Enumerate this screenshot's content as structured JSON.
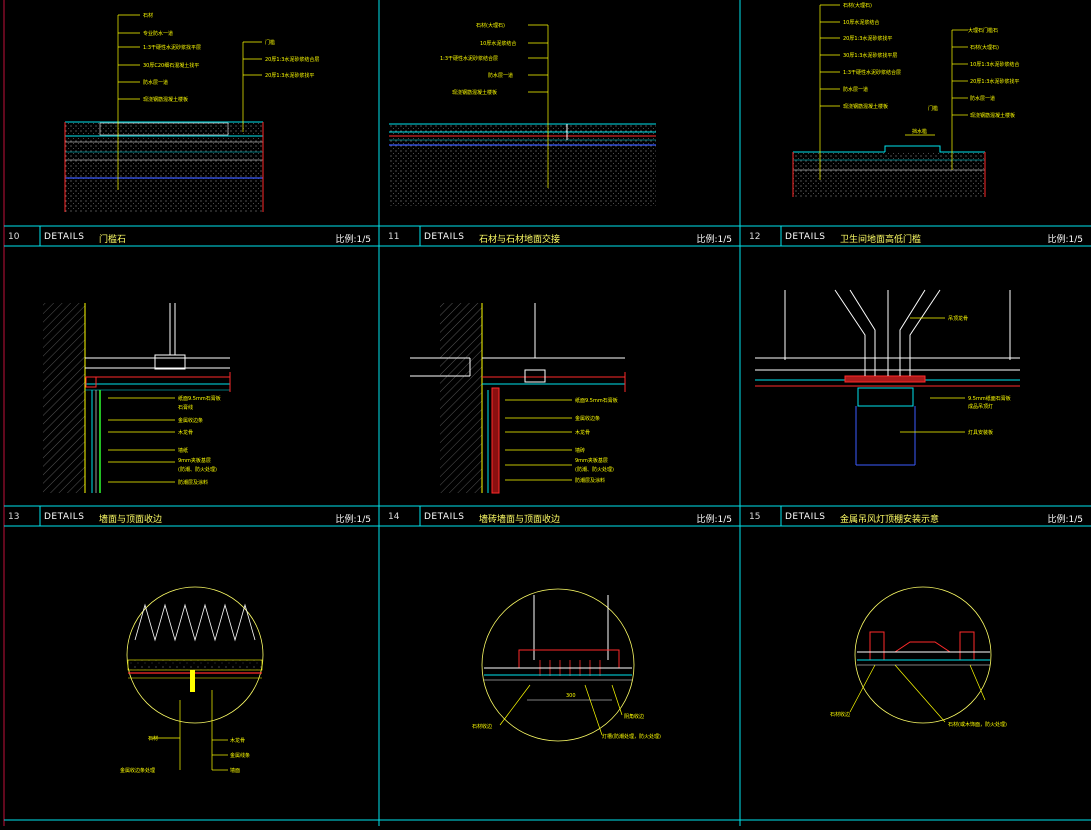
{
  "drawing": {
    "colors": {
      "frame": "#00e5ee",
      "note": "#ffff00",
      "red": "#ff2a2a",
      "blue": "#3b5bff",
      "green": "#2fff2f",
      "white": "#ffffff",
      "gray": "#9a9a9a"
    }
  },
  "details": [
    {
      "num": "10",
      "label": "DETAILS",
      "name": "门槛石",
      "scale": "比例:1/5"
    },
    {
      "num": "11",
      "label": "DETAILS",
      "name": "石材与石材地面交接",
      "scale": "比例:1/5"
    },
    {
      "num": "12",
      "label": "DETAILS",
      "name": "卫生间地面高低门槛",
      "scale": "比例:1/5"
    },
    {
      "num": "13",
      "label": "DETAILS",
      "name": "墙面与顶面收边",
      "scale": "比例:1/5"
    },
    {
      "num": "14",
      "label": "DETAILS",
      "name": "墙砖墙面与顶面收边",
      "scale": "比例:1/5"
    },
    {
      "num": "15",
      "label": "DETAILS",
      "name": "金属吊风灯顶棚安装示意",
      "scale": "比例:1/5"
    }
  ],
  "notes": {
    "d10_left": [
      "石材",
      "专业防水一道",
      "1:3干硬性水泥砂浆找平层",
      "30厚C20细石混凝土找平",
      "防水层一道",
      "现浇钢筋混凝土楼板"
    ],
    "d10_right": [
      "门槛",
      "20厚1:3水泥砂浆结合层",
      "20厚1:3水泥砂浆找平"
    ],
    "d11": [
      "石材(大理石)",
      "10厚水泥浆结合",
      "1:3干硬性水泥砂浆结合层",
      "防水层一道",
      "现浇钢筋混凝土楼板"
    ],
    "d12_left": [
      "石材(大理石)",
      "10厚水泥浆结合",
      "20厚1:3水泥砂浆找平",
      "30厚1:3水泥砂浆找平层",
      "1:3干硬性水泥砂浆结合层",
      "防水层一道",
      "现浇钢筋混凝土楼板"
    ],
    "d12_right": [
      "大理石门槛石",
      "石材(大理石)",
      "10厚1:3水泥砂浆结合",
      "20厚1:3水泥砂浆找平",
      "防水层一道",
      "现浇钢筋混凝土楼板"
    ],
    "d12_misc": [
      "门槛",
      "挡水槛"
    ],
    "d13": [
      "纸面9.5mm石膏板",
      "石膏线",
      "金属收边条",
      "木龙骨",
      "墙纸",
      "9mm夹板基层",
      "(防潮、防火处理)",
      "防潮层及涂料"
    ],
    "d14": [
      "纸面9.5mm石膏板",
      "金属收边条",
      "木龙骨",
      "墙砖",
      "9mm夹板基层",
      "(防潮、防火处理)",
      "防潮层及涂料"
    ],
    "d15": [
      "吊顶龙骨",
      "9.5mm纸面石膏板",
      "成品吊顶灯",
      "灯具安装板"
    ],
    "c13": [
      "石材",
      "木龙骨",
      "金属线条",
      "墙面"
    ],
    "c13_bottom": "金属收边条处理",
    "c14": [
      "石材收边",
      "灯槽(防潮处理，防火处理)",
      "阴角收边"
    ],
    "c14_dim": "300",
    "c15": [
      "石材收边",
      "石材(或木饰面，防火处理)"
    ]
  }
}
